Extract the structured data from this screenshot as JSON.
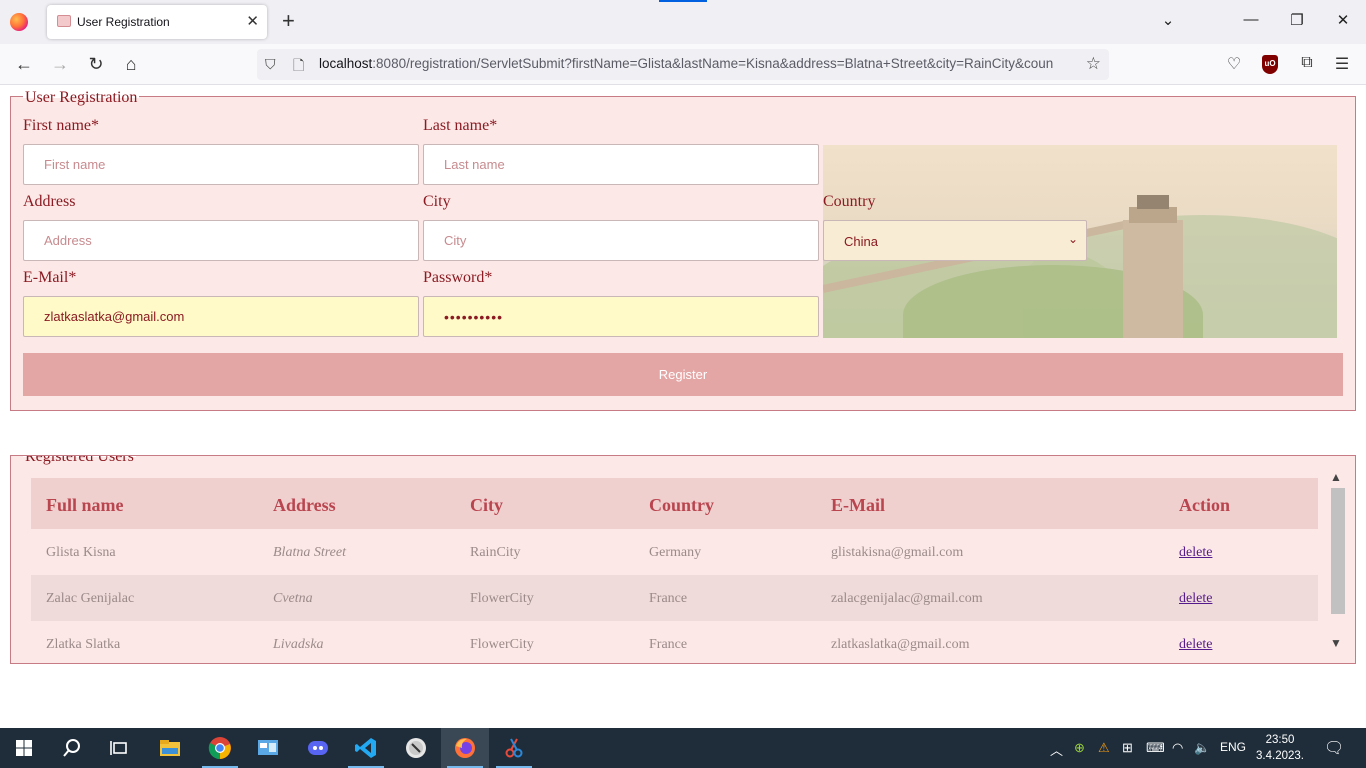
{
  "browser": {
    "tab_title": "User Registration",
    "new_tab_label": "+",
    "url_host": "localhost",
    "url_rest": ":8080/registration/ServletSubmit?firstName=Glista&lastName=Kisna&address=Blatna+Street&city=RainCity&coun"
  },
  "form": {
    "legend": "User Registration",
    "first_name_label": "First name*",
    "first_name_placeholder": "First name",
    "last_name_label": "Last name*",
    "last_name_placeholder": "Last name",
    "address_label": "Address",
    "address_placeholder": "Address",
    "city_label": "City",
    "city_placeholder": "City",
    "country_label": "Country",
    "country_selected": "China",
    "email_label": "E-Mail*",
    "email_value": "zlatkaslatka@gmail.com",
    "password_label": "Password*",
    "password_masked": "••••••••••",
    "register_label": "Register"
  },
  "users": {
    "legend": "Registered Users",
    "columns": [
      "Full name",
      "Address",
      "City",
      "Country",
      "E-Mail",
      "Action"
    ],
    "rows": [
      {
        "name": "Glista Kisna",
        "address": "Blatna Street",
        "city": "RainCity",
        "country": "Germany",
        "email": "glistakisna@gmail.com",
        "action": "delete"
      },
      {
        "name": "Zalac Genijalac",
        "address": "Cvetna",
        "city": "FlowerCity",
        "country": "France",
        "email": "zalacgenijalac@gmail.com",
        "action": "delete"
      },
      {
        "name": "Zlatka Slatka",
        "address": "Livadska",
        "city": "FlowerCity",
        "country": "France",
        "email": "zlatkaslatka@gmail.com",
        "action": "delete"
      }
    ]
  },
  "taskbar": {
    "language": "ENG",
    "time": "23:50",
    "date": "3.4.2023."
  },
  "colors": {
    "accent": "#8b1a22",
    "form_bg": "#fce9e7",
    "button": "#e4a5a5",
    "header_row": "#efd0cf"
  }
}
